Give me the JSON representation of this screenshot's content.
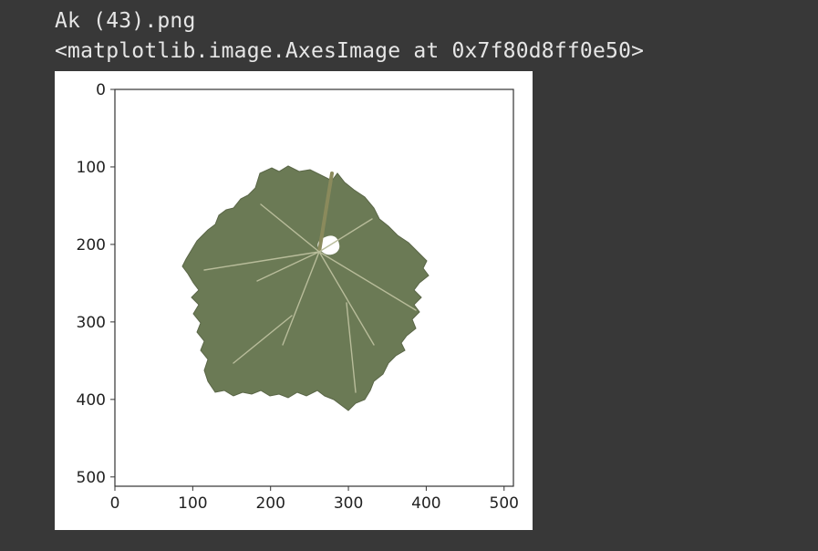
{
  "output": {
    "filename": "Ak (43).png",
    "repr": "<matplotlib.image.AxesImage at 0x7f80d8ff0e50>"
  },
  "plot": {
    "x_ticks": [
      "0",
      "100",
      "200",
      "300",
      "400",
      "500"
    ],
    "y_ticks": [
      "0",
      "100",
      "200",
      "300",
      "400",
      "500"
    ],
    "image_subject": "grape-leaf-icon",
    "colors": {
      "background": "#383838",
      "leaf": "#6b7a55",
      "leaf_dark": "#55613f",
      "vein": "#b8bc9a",
      "text": "#e6e6e6"
    }
  }
}
